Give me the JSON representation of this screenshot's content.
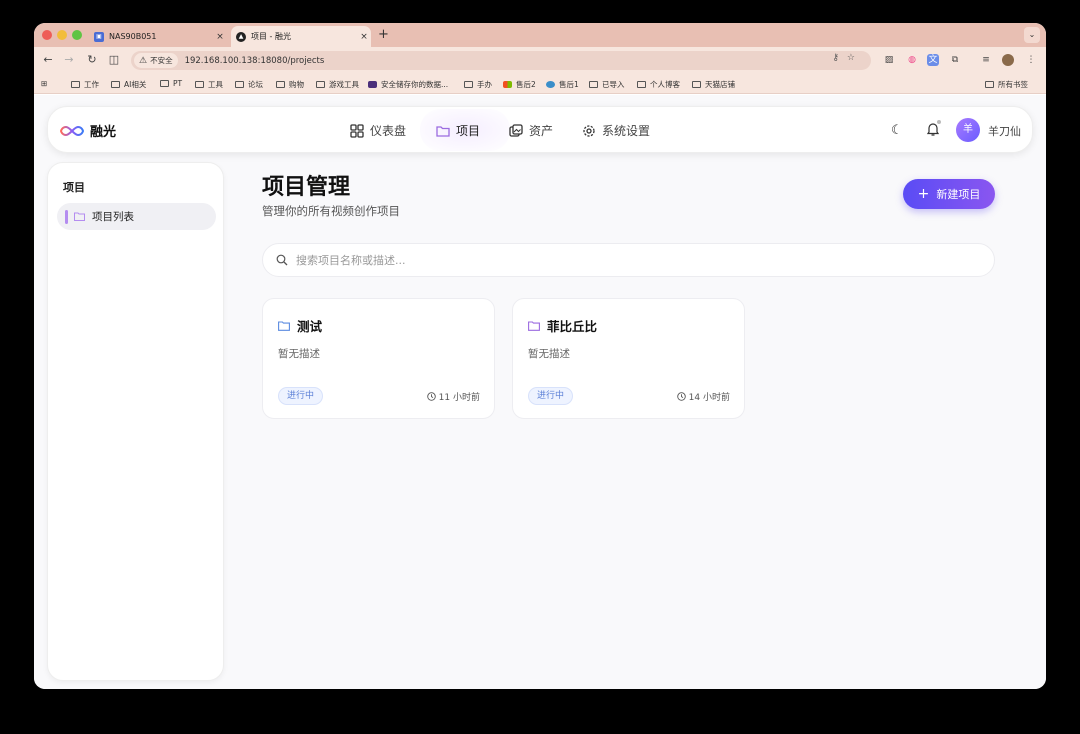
{
  "browser": {
    "tabs": [
      {
        "title": "NAS90B051",
        "close": "×"
      },
      {
        "title": "项目 - 融光",
        "close": "×"
      }
    ],
    "new_tab": "+",
    "security_label": "不安全",
    "url": "192.168.100.138:18080/projects",
    "bookmarks": [
      "工作",
      "AI相关",
      "PT",
      "工具",
      "论坛",
      "购物",
      "游戏工具",
      "安全储存你的数据...",
      "手办",
      "售后2",
      "售后1",
      "已导入",
      "个人博客",
      "天猫店铺"
    ],
    "all_bookmarks": "所有书签"
  },
  "app": {
    "brand": "融光",
    "nav": [
      {
        "label": "仪表盘",
        "icon": "dashboard-icon"
      },
      {
        "label": "项目",
        "icon": "folder-icon"
      },
      {
        "label": "资产",
        "icon": "assets-icon"
      },
      {
        "label": "系统设置",
        "icon": "gear-icon"
      }
    ],
    "user": {
      "avatar_text": "羊",
      "name": "羊刀仙"
    },
    "accent": "#6a52f3"
  },
  "sidebar": {
    "title": "项目",
    "items": [
      {
        "label": "项目列表"
      }
    ]
  },
  "main": {
    "title": "项目管理",
    "subtitle": "管理你的所有视频创作项目",
    "new_button": "新建项目",
    "search_placeholder": "搜索项目名称或描述...",
    "projects": [
      {
        "name": "测试",
        "description": "暂无描述",
        "status": "进行中",
        "updated": "11 小时前"
      },
      {
        "name": "菲比丘比",
        "description": "暂无描述",
        "status": "进行中",
        "updated": "14 小时前"
      }
    ]
  }
}
